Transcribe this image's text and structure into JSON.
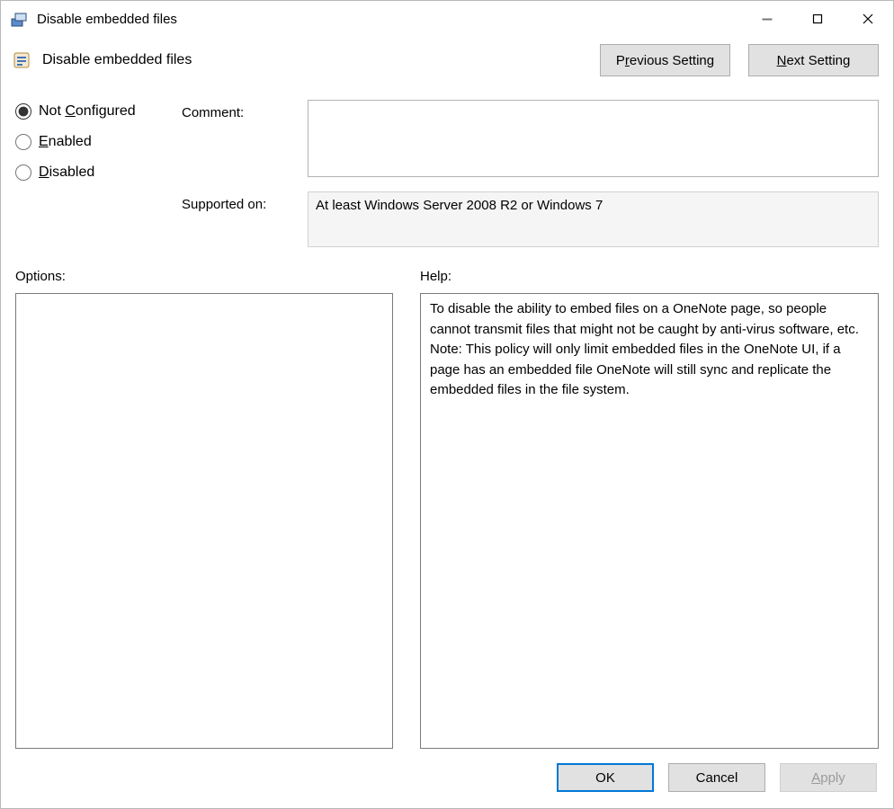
{
  "window": {
    "title": "Disable embedded files"
  },
  "header": {
    "policy_name": "Disable embedded files",
    "previous_prefix": "P",
    "previous_accel": "r",
    "previous_suffix": "evious Setting",
    "next_prefix": "",
    "next_accel": "N",
    "next_suffix": "ext Setting"
  },
  "state": {
    "not_configured_prefix": "Not ",
    "not_configured_accel": "C",
    "not_configured_suffix": "onfigured",
    "enabled_accel": "E",
    "enabled_suffix": "nabled",
    "disabled_accel": "D",
    "disabled_suffix": "isabled",
    "selected": "not_configured"
  },
  "fields": {
    "comment_label": "Comment:",
    "comment_value": "",
    "supported_label": "Supported on:",
    "supported_value": "At least Windows Server 2008 R2 or Windows 7"
  },
  "lower": {
    "options_label": "Options:",
    "help_label": "Help:",
    "options_content": "",
    "help_content": "To disable the ability to embed files on a OneNote page, so people cannot transmit files that might not be caught by anti-virus software, etc.  Note: This policy will only limit embedded files in the OneNote UI, if a page has an embedded file OneNote will still sync and replicate the embedded files in the file system."
  },
  "buttons": {
    "ok": "OK",
    "cancel": "Cancel",
    "apply_accel": "A",
    "apply_suffix": "pply"
  }
}
